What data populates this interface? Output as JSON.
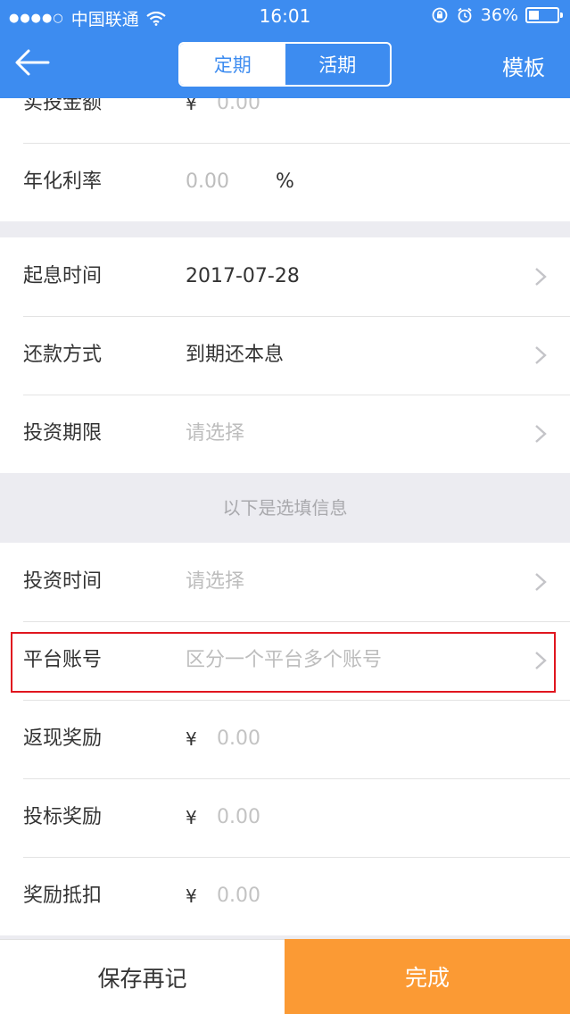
{
  "status": {
    "carrier": "中国联通",
    "time": "16:01",
    "battery": "36%"
  },
  "nav": {
    "tabs": [
      "定期",
      "活期"
    ],
    "active_tab": "定期",
    "template": "模板"
  },
  "form": {
    "actual_amount": {
      "label": "实投金额",
      "currency": "¥",
      "placeholder": "0.00"
    },
    "annual_rate": {
      "label": "年化利率",
      "placeholder": "0.00",
      "unit": "%"
    },
    "start_date": {
      "label": "起息时间",
      "value": "2017-07-28"
    },
    "repayment": {
      "label": "还款方式",
      "value": "到期还本息"
    },
    "term": {
      "label": "投资期限",
      "placeholder": "请选择"
    },
    "optional_header": "以下是选填信息",
    "invest_time": {
      "label": "投资时间",
      "placeholder": "请选择"
    },
    "platform_account": {
      "label": "平台账号",
      "placeholder": "区分一个平台多个账号"
    },
    "cashback": {
      "label": "返现奖励",
      "currency": "¥",
      "placeholder": "0.00"
    },
    "bid_reward": {
      "label": "投标奖励",
      "currency": "¥",
      "placeholder": "0.00"
    },
    "reward_deduction": {
      "label": "奖励抵扣",
      "currency": "¥",
      "placeholder": "0.00"
    }
  },
  "footer": {
    "save_again": "保存再记",
    "done": "完成"
  },
  "colors": {
    "primary": "#3d8cf0",
    "accent": "#fb9a34",
    "highlight": "#e0161f"
  }
}
